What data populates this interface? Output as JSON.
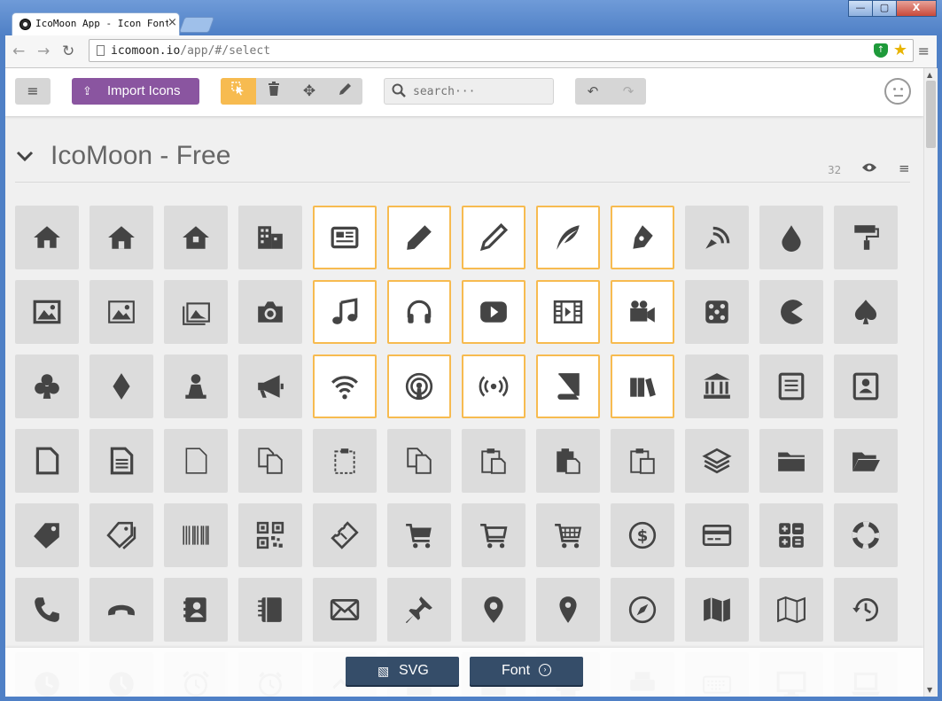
{
  "browser": {
    "tab_title": "IcoMoon App - Icon Font",
    "url_host": "icomoon.io",
    "url_path": "/app/#/select",
    "window_buttons": [
      "—",
      "▢",
      "X"
    ]
  },
  "app": {
    "import_label": "Import Icons",
    "search_placeholder": "search···",
    "set_title": "IcoMoon - Free",
    "set_count": "32",
    "accent_color": "#f7bb50",
    "import_color": "#8a55a0",
    "icons": [
      [
        "home-icon",
        "home2-icon",
        "home3-icon",
        "office-icon",
        "newspaper-icon",
        "pencil-icon",
        "pencil2-icon",
        "quill-icon",
        "pen-icon",
        "blog-icon",
        "droplet-icon",
        "paint-format-icon"
      ],
      [
        "image-icon",
        "image2-icon",
        "images-icon",
        "camera-icon",
        "music-icon",
        "headphones-icon",
        "play-icon",
        "film-icon",
        "video-camera-icon",
        "dice-icon",
        "pacman-icon",
        "spades-icon"
      ],
      [
        "clubs-icon",
        "diamonds-icon",
        "pawn-icon",
        "bullhorn-icon",
        "connection-icon",
        "podcast-icon",
        "feed-icon",
        "book-icon",
        "books-icon",
        "library-icon",
        "file-text-icon",
        "profile-icon"
      ],
      [
        "file-empty-icon",
        "file-text2-icon",
        "file-empty2-icon",
        "files-empty-icon",
        "file-clipboard-icon",
        "copy-icon",
        "paste-icon",
        "paste2-icon",
        "paste3-icon",
        "stack-icon",
        "folder-icon",
        "folder-open-icon"
      ],
      [
        "price-tag-icon",
        "price-tags-icon",
        "barcode-icon",
        "qrcode-icon",
        "ticket-icon",
        "cart-icon",
        "cart2-icon",
        "cart3-icon",
        "coin-dollar-icon",
        "credit-card-icon",
        "calculator-icon",
        "lifebuoy-icon"
      ],
      [
        "phone-icon",
        "phone-hang-up-icon",
        "address-book-icon",
        "notebook-icon",
        "envelop-icon",
        "pushpin-icon",
        "location-icon",
        "location2-icon",
        "compass-icon",
        "map-icon",
        "map2-icon",
        "history-icon"
      ],
      [
        "clock-icon",
        "clock2-icon",
        "alarm-icon",
        "bell-icon",
        "stopwatch-icon",
        "calendar-icon",
        "calendar2-icon",
        "printer-icon",
        "printer2-icon",
        "keyboard-icon",
        "display-icon",
        "laptop-icon"
      ]
    ],
    "selected_cells": [
      4,
      5,
      6,
      7,
      8,
      16,
      17,
      18,
      19,
      20,
      28,
      29,
      30,
      31,
      32
    ]
  },
  "export": {
    "svg_label": "SVG",
    "font_label": "Font"
  }
}
